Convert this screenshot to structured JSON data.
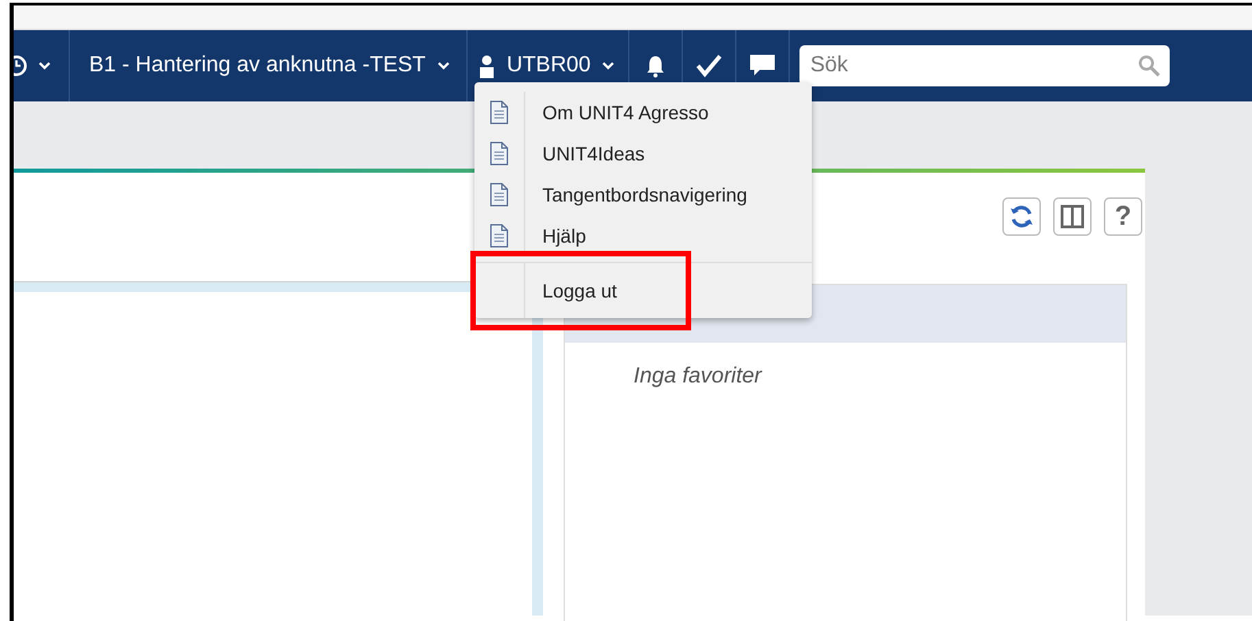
{
  "nav": {
    "title": "B1 - Hantering av anknutna -TEST",
    "user": "UTBR00",
    "search": {
      "placeholder": "Sök"
    }
  },
  "user_menu": {
    "items": [
      {
        "kind": "doc",
        "label": "Om UNIT4 Agresso",
        "highlighted": false
      },
      {
        "kind": "doc",
        "label": "UNIT4Ideas",
        "highlighted": false
      },
      {
        "kind": "doc",
        "label": "Tangentbordsnavigering",
        "highlighted": false
      },
      {
        "kind": "doc",
        "label": "Hjälp",
        "highlighted": false
      },
      {
        "kind": "plain",
        "label": "Logga ut",
        "highlighted": true
      }
    ]
  },
  "panel": {
    "help_label": "?"
  },
  "favorites": {
    "empty_text": "Inga favoriter"
  }
}
